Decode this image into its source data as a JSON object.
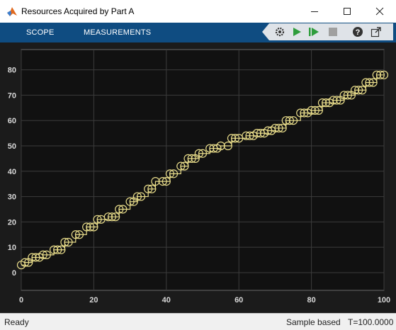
{
  "window": {
    "title": "Resources Acquired by Part A",
    "minimize_icon": "minimize-icon",
    "maximize_icon": "maximize-icon",
    "close_icon": "close-icon"
  },
  "ribbon": {
    "tabs": [
      {
        "label": "SCOPE"
      },
      {
        "label": "MEASUREMENTS"
      }
    ],
    "tools": [
      "settings-gear-icon",
      "run-icon",
      "step-forward-icon",
      "stop-icon",
      "help-icon",
      "undock-icon"
    ]
  },
  "status": {
    "left": "Ready",
    "mode": "Sample based",
    "time": "T=100.0000"
  },
  "colors": {
    "plot_bg": "#111111",
    "frame_bg": "#1b1b1b",
    "line": "#e8dc8a",
    "marker": "#e8dc8a",
    "grid": "#3c3c3c",
    "ribbon": "#0f4c81"
  },
  "chart_data": {
    "type": "line",
    "style": "stairs with circle markers",
    "xlim": [
      0,
      100
    ],
    "ylim": [
      -7,
      88
    ],
    "xticks": [
      "0",
      "20",
      "40",
      "60",
      "80",
      "100"
    ],
    "yticks": [
      "0",
      "10",
      "20",
      "30",
      "40",
      "50",
      "60",
      "70",
      "80"
    ],
    "grid": true,
    "series": [
      {
        "x": [
          0,
          1,
          2,
          3,
          4,
          5,
          6,
          7,
          9,
          10,
          11,
          12,
          13,
          15,
          16,
          18,
          19,
          20,
          21,
          22,
          24,
          25,
          26,
          27,
          28,
          30,
          31,
          32,
          33,
          35,
          36,
          37,
          39,
          40,
          41,
          42,
          44,
          45,
          46,
          47,
          48,
          49,
          50,
          52,
          53,
          54,
          55,
          57,
          58,
          59,
          60,
          62,
          63,
          64,
          65,
          66,
          67,
          68,
          69,
          70,
          71,
          72,
          73,
          74,
          75,
          77,
          78,
          79,
          80,
          81,
          82,
          83,
          84,
          85,
          86,
          87,
          88,
          89,
          90,
          91,
          92,
          93,
          94,
          95,
          96,
          97,
          98,
          99,
          100
        ],
        "y": [
          3,
          4,
          4,
          6,
          6,
          6,
          7,
          7,
          9,
          9,
          9,
          12,
          12,
          15,
          15,
          18,
          18,
          18,
          21,
          21,
          22,
          22,
          22,
          25,
          25,
          28,
          28,
          30,
          30,
          33,
          33,
          36,
          36,
          36,
          39,
          39,
          42,
          42,
          45,
          45,
          45,
          47,
          47,
          49,
          49,
          49,
          50,
          50,
          53,
          53,
          53,
          54,
          54,
          54,
          55,
          55,
          55,
          56,
          56,
          57,
          57,
          57,
          60,
          60,
          60,
          63,
          63,
          63,
          64,
          64,
          64,
          67,
          67,
          67,
          68,
          68,
          68,
          70,
          70,
          70,
          72,
          72,
          72,
          75,
          75,
          75,
          78,
          78,
          78
        ]
      }
    ]
  }
}
